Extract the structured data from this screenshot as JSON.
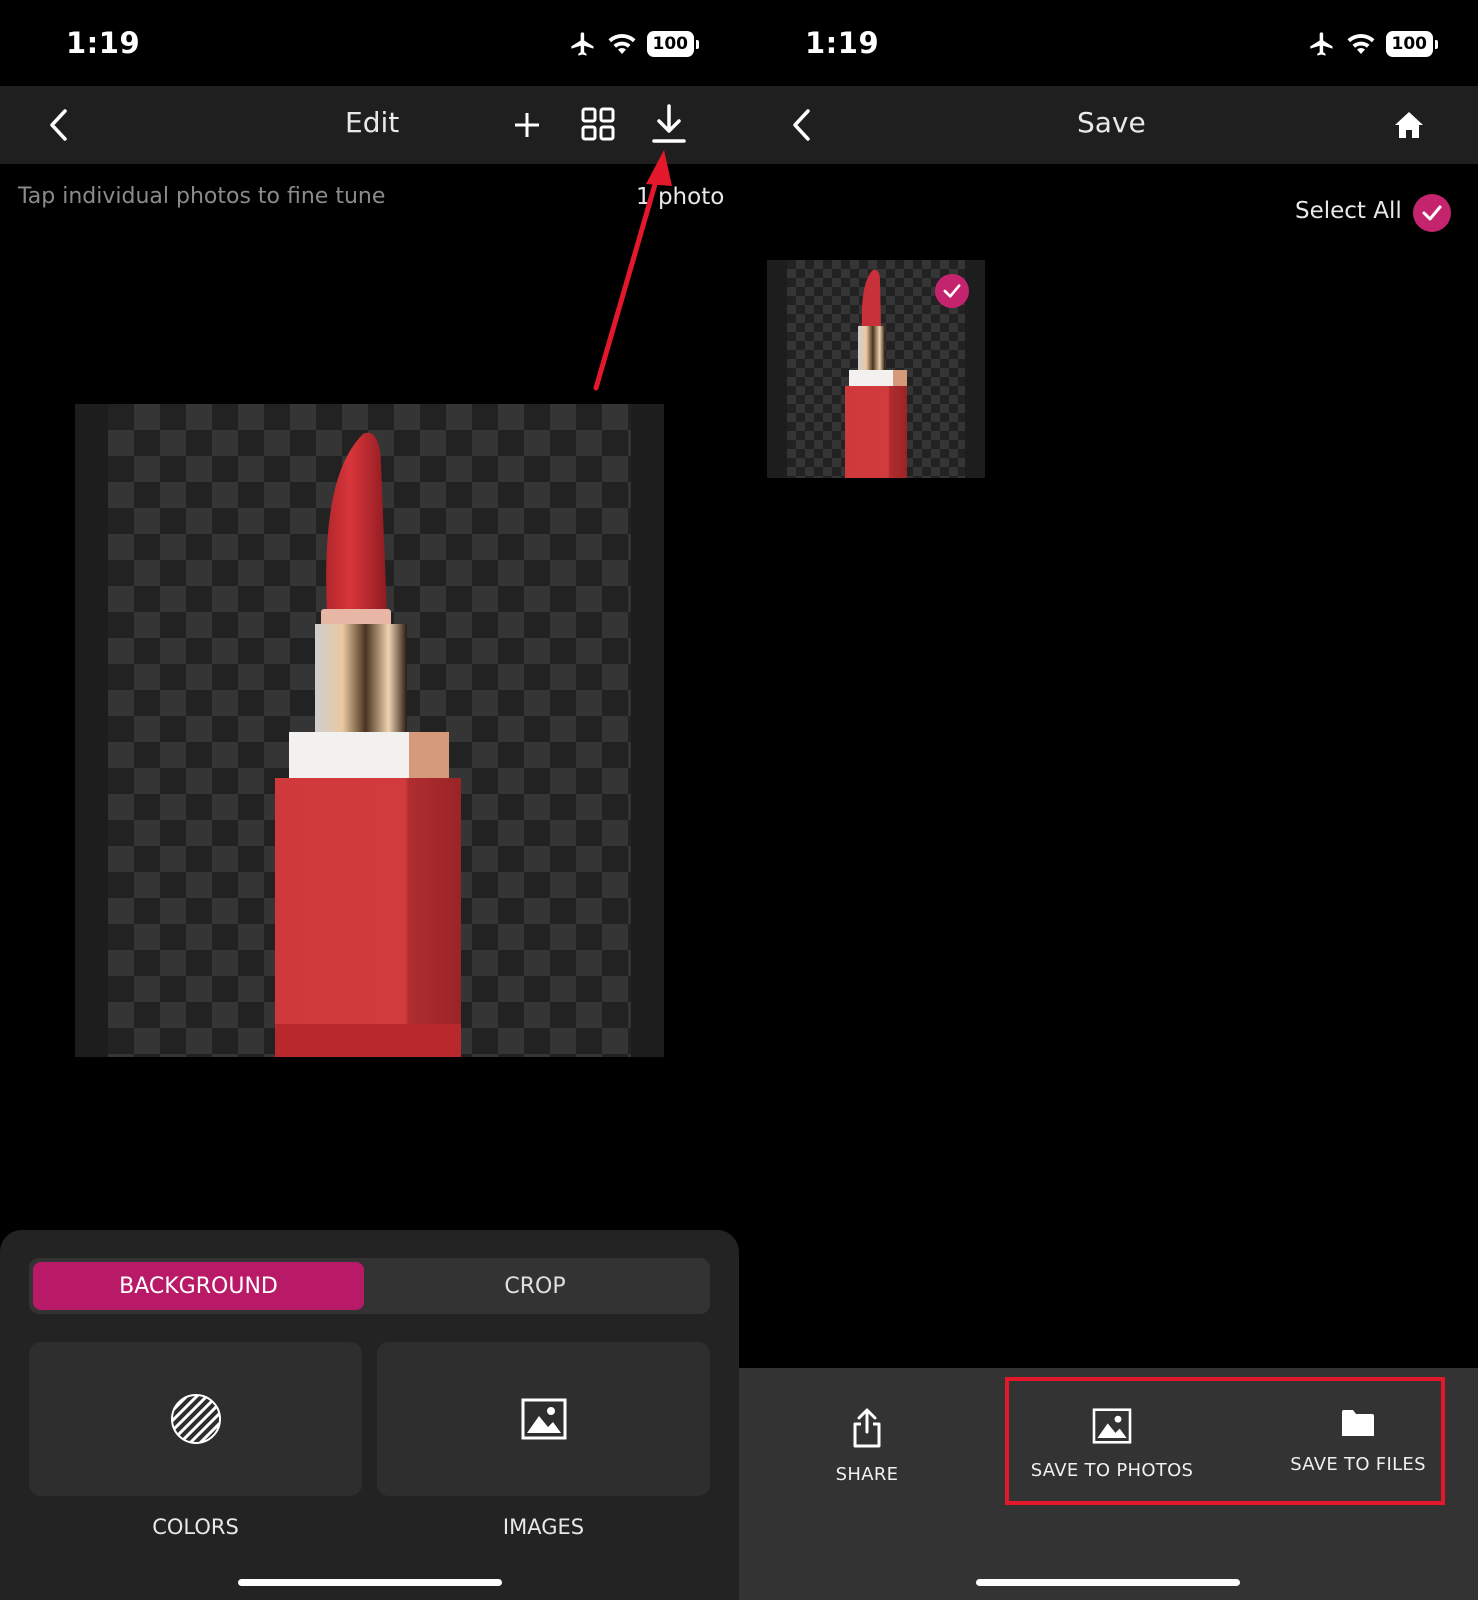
{
  "left": {
    "status": {
      "time": "1:19",
      "battery": "100"
    },
    "nav": {
      "title": "Edit",
      "back_icon": "chevron-left-icon",
      "add_icon": "plus-icon",
      "grid_icon": "grid-icon",
      "download_icon": "download-icon"
    },
    "hint": "Tap individual photos to fine tune",
    "count": "1 photo",
    "tabs": {
      "background": "BACKGROUND",
      "crop": "CROP"
    },
    "tiles": {
      "colors": "COLORS",
      "images": "IMAGES"
    }
  },
  "right": {
    "status": {
      "time": "1:19",
      "battery": "100"
    },
    "nav": {
      "title": "Save",
      "back_icon": "chevron-left-icon",
      "home_icon": "home-icon"
    },
    "select_all": "Select All",
    "actions": {
      "share": "SHARE",
      "save_photos": "SAVE TO PHOTOS",
      "save_files": "SAVE TO FILES"
    }
  },
  "colors": {
    "accent": "#b81a67",
    "check": "#c4246e",
    "highlight": "#e3182a",
    "lipstick": "#d0393b"
  }
}
